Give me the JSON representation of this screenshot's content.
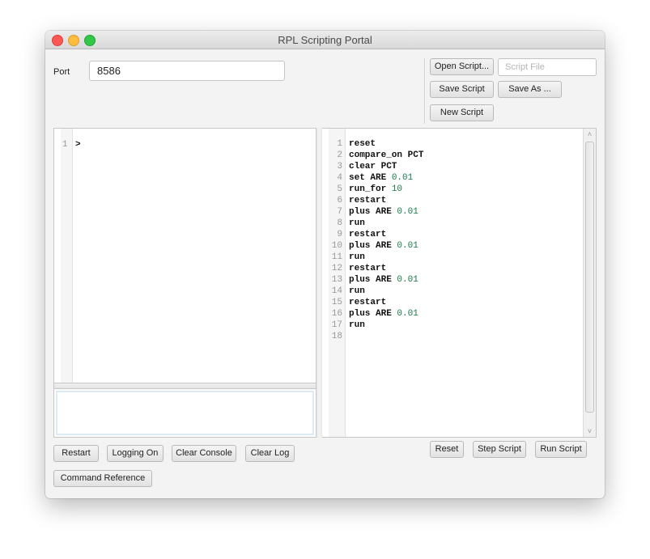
{
  "window": {
    "title": "RPL Scripting Portal"
  },
  "connection": {
    "port_label": "Port",
    "port_value": "8586"
  },
  "file_controls": {
    "open_script": "Open Script...",
    "script_file_placeholder": "Script File",
    "script_file_value": "",
    "save_script": "Save Script",
    "save_as": "Save As ...",
    "new_script": "New Script"
  },
  "console": {
    "lines": [
      {
        "number": "1",
        "text": ">"
      }
    ],
    "input_value": ""
  },
  "console_buttons": {
    "restart": "Restart",
    "logging": "Logging On",
    "clear_console": "Clear Console",
    "clear_log": "Clear Log",
    "command_reference": "Command Reference"
  },
  "script": {
    "lines": [
      {
        "number": "1",
        "tokens": [
          {
            "t": "reset",
            "c": "kw"
          }
        ]
      },
      {
        "number": "2",
        "tokens": [
          {
            "t": "compare_on PCT",
            "c": "kw"
          }
        ]
      },
      {
        "number": "3",
        "tokens": [
          {
            "t": "clear PCT",
            "c": "kw"
          }
        ]
      },
      {
        "number": "4",
        "tokens": [
          {
            "t": "set ARE ",
            "c": "kw"
          },
          {
            "t": "0.01",
            "c": "num"
          }
        ]
      },
      {
        "number": "5",
        "tokens": [
          {
            "t": "run_for ",
            "c": "kw"
          },
          {
            "t": "10",
            "c": "num"
          }
        ]
      },
      {
        "number": "6",
        "tokens": [
          {
            "t": "restart",
            "c": "kw"
          }
        ]
      },
      {
        "number": "7",
        "tokens": [
          {
            "t": "plus ARE ",
            "c": "kw"
          },
          {
            "t": "0.01",
            "c": "num"
          }
        ]
      },
      {
        "number": "8",
        "tokens": [
          {
            "t": "run",
            "c": "kw"
          }
        ]
      },
      {
        "number": "9",
        "tokens": [
          {
            "t": "restart",
            "c": "kw"
          }
        ]
      },
      {
        "number": "10",
        "tokens": [
          {
            "t": "plus ARE ",
            "c": "kw"
          },
          {
            "t": "0.01",
            "c": "num"
          }
        ]
      },
      {
        "number": "11",
        "tokens": [
          {
            "t": "run",
            "c": "kw"
          }
        ]
      },
      {
        "number": "12",
        "tokens": [
          {
            "t": "restart",
            "c": "kw"
          }
        ]
      },
      {
        "number": "13",
        "tokens": [
          {
            "t": "plus ARE ",
            "c": "kw"
          },
          {
            "t": "0.01",
            "c": "num"
          }
        ]
      },
      {
        "number": "14",
        "tokens": [
          {
            "t": "run",
            "c": "kw"
          }
        ]
      },
      {
        "number": "15",
        "tokens": [
          {
            "t": "restart",
            "c": "kw"
          }
        ]
      },
      {
        "number": "16",
        "tokens": [
          {
            "t": "plus ARE ",
            "c": "kw"
          },
          {
            "t": "0.01",
            "c": "num"
          }
        ]
      },
      {
        "number": "17",
        "tokens": [
          {
            "t": "run",
            "c": "kw"
          }
        ]
      },
      {
        "number": "18",
        "tokens": []
      }
    ]
  },
  "script_buttons": {
    "reset": "Reset",
    "step_script": "Step Script",
    "run_script": "Run Script"
  },
  "icons": {
    "scroll_up": "˄",
    "scroll_down": "˅"
  },
  "colors": {
    "keyword": "#111111",
    "number": "#1a7a4a",
    "close": "#fc5753",
    "minimize": "#fdbc40",
    "maximize": "#33c748"
  }
}
